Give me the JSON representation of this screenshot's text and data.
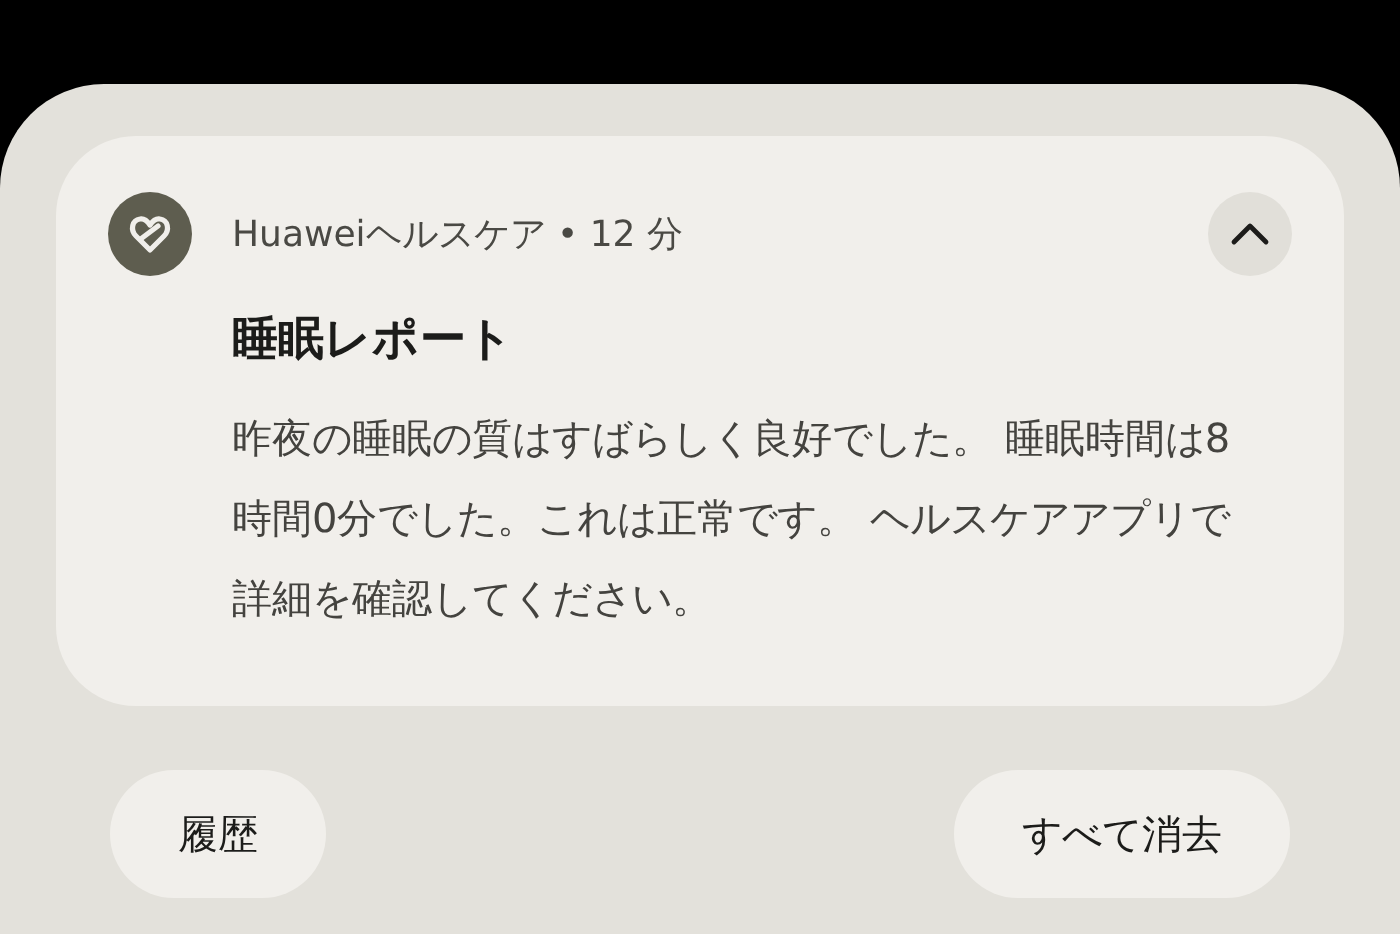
{
  "notification": {
    "app_name": "Huaweiヘルスケア",
    "separator": "•",
    "time": "12 分",
    "expanded": true,
    "title": "睡眠レポート",
    "body": "昨夜の睡眠の質はすばらしく良好でした。 睡眠時間は8時間0分でした。これは正常です。 ヘルスケアアプリで詳細を確認してください。"
  },
  "buttons": [
    {
      "label": "履歴"
    },
    {
      "label": "すべて消去"
    }
  ]
}
